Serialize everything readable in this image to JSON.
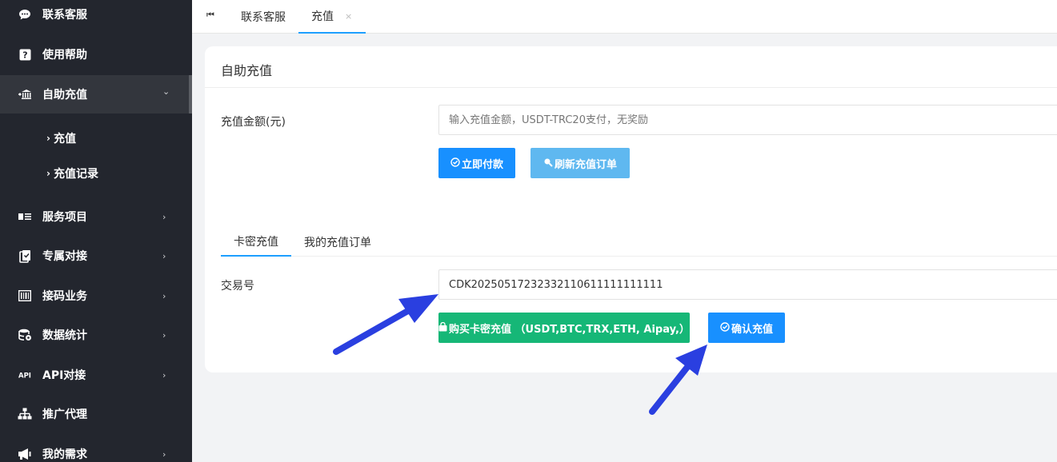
{
  "sidebar": {
    "items": [
      {
        "label": "联系客服",
        "icon": "chat-icon",
        "has_chevron": false
      },
      {
        "label": "使用帮助",
        "icon": "question-icon",
        "has_chevron": false
      },
      {
        "label": "自助充值",
        "icon": "bank-icon",
        "has_chevron": true,
        "expanded": true
      },
      {
        "label": "服务项目",
        "icon": "list-icon",
        "has_chevron": true
      },
      {
        "label": "专属对接",
        "icon": "clipboard-icon",
        "has_chevron": true
      },
      {
        "label": "接码业务",
        "icon": "barcode-icon",
        "has_chevron": true
      },
      {
        "label": "数据统计",
        "icon": "database-icon",
        "has_chevron": true
      },
      {
        "label": "API对接",
        "icon": "api-icon",
        "has_chevron": true
      },
      {
        "label": "推广代理",
        "icon": "sitemap-icon",
        "has_chevron": false
      },
      {
        "label": "我的需求",
        "icon": "megaphone-icon",
        "has_chevron": true
      }
    ],
    "sub_items": [
      {
        "label": "充值"
      },
      {
        "label": "充值记录"
      }
    ]
  },
  "tabbar": {
    "tabs": [
      {
        "label": "联系客服"
      },
      {
        "label": "充值",
        "active": true,
        "closable": true
      }
    ],
    "close_glyph": "×"
  },
  "card": {
    "title": "自助充值",
    "amount": {
      "label": "充值金额(元)",
      "placeholder": "输入充值金额，USDT-TRC20支付，无奖励",
      "value": ""
    },
    "pay_button": "立即付款",
    "refresh_button": "刷新充值订单",
    "subtabs": [
      {
        "label": "卡密充值",
        "active": true
      },
      {
        "label": "我的充值订单"
      }
    ],
    "trade": {
      "label": "交易号",
      "value": "CDK20250517232332110611111111111"
    },
    "buy_button": "购买卡密充值 （USDT,BTC,TRX,ETH, Aipay,）",
    "confirm_button": "确认充值"
  },
  "colors": {
    "sidebar_bg": "#23262e",
    "primary_blue": "#1e9fff",
    "light_blue": "#5fb8f0",
    "green": "#16b777",
    "annotation_arrow": "#2a3fe0"
  }
}
